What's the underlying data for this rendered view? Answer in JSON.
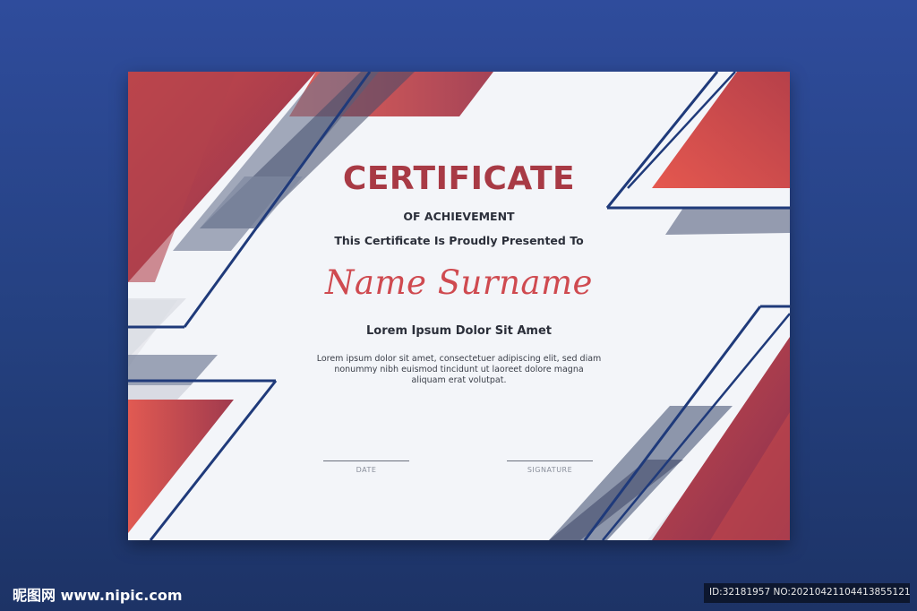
{
  "certificate": {
    "title": "CERTIFICATE",
    "subtitle": "OF ACHIEVEMENT",
    "presented_to": "This Certificate Is Proudly Presented To",
    "recipient_name": "Name Surname",
    "heading": "Lorem Ipsum Dolor Sit Amet",
    "body": "Lorem ipsum dolor sit amet, consectetuer adipiscing elit, sed diam nonummy nibh euismod tincidunt ut laoreet dolore magna aliquam erat volutpat.",
    "date_label": "DATE",
    "signature_label": "SIGNATURE"
  },
  "watermark": {
    "logo_text": "昵图网 www.nipic.com",
    "id_text": "ID:32181957 NO:20210421104413855121"
  },
  "colors": {
    "accent_red": "#a83a45",
    "name_red": "#cf4a50",
    "navy": "#1f3a7a",
    "background_blue": "#2f4c9c"
  }
}
